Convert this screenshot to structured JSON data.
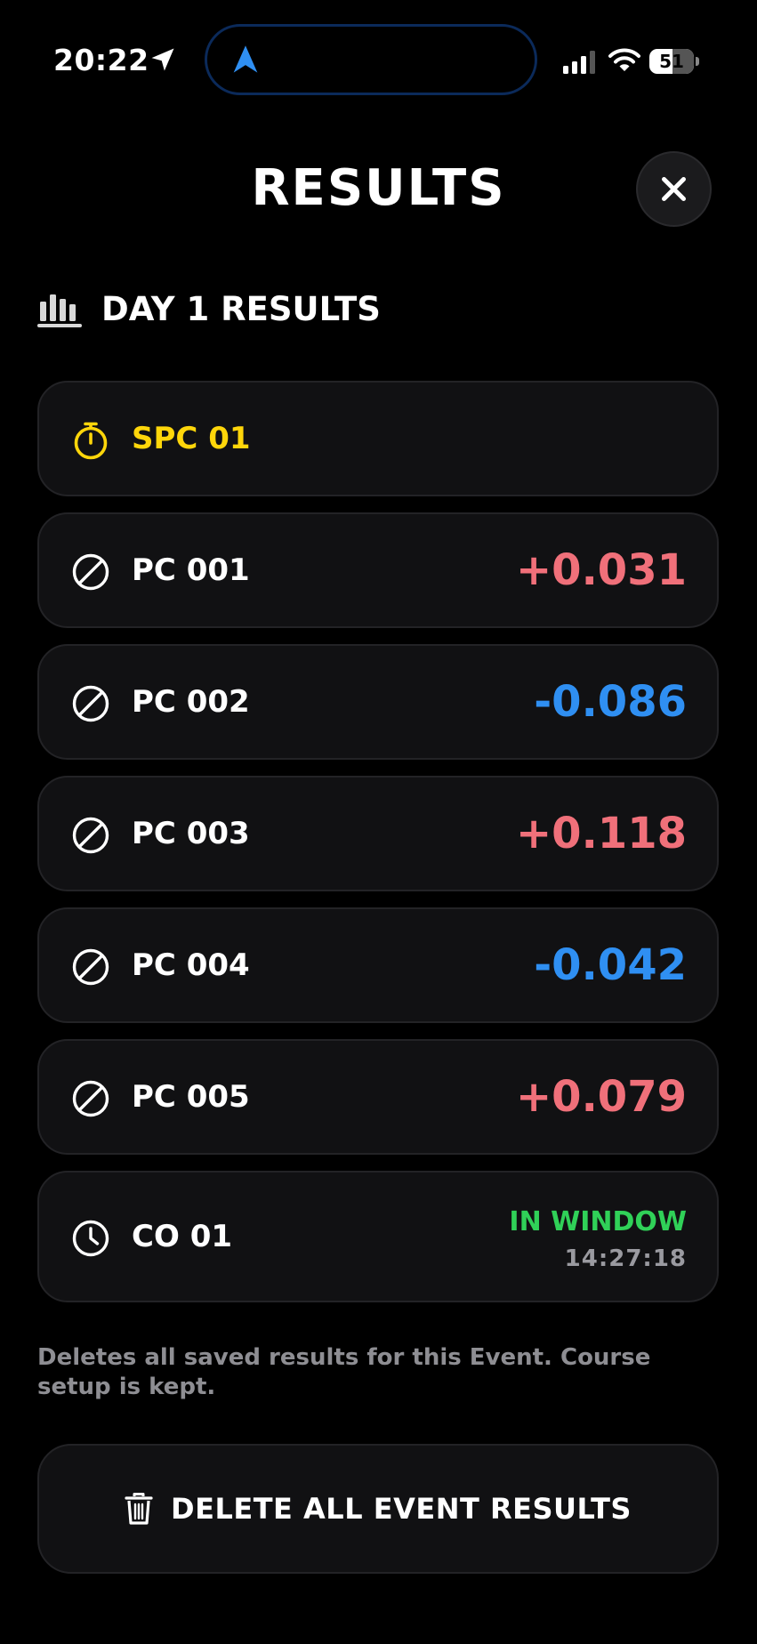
{
  "status_bar": {
    "time": "20:22",
    "battery": "51",
    "battery_level": 0.51
  },
  "header": {
    "title": "RESULTS"
  },
  "section": {
    "title": "DAY 1 RESULTS"
  },
  "results": [
    {
      "label": "SPC 01",
      "icon": "stopwatch-icon",
      "value": ""
    },
    {
      "label": "PC 001",
      "icon": "prohibited-icon",
      "value": "+0.031"
    },
    {
      "label": "PC 002",
      "icon": "prohibited-icon",
      "value": "-0.086"
    },
    {
      "label": "PC 003",
      "icon": "prohibited-icon",
      "value": "+0.118"
    },
    {
      "label": "PC 004",
      "icon": "prohibited-icon",
      "value": "-0.042"
    },
    {
      "label": "PC 005",
      "icon": "prohibited-icon",
      "value": "+0.079"
    },
    {
      "label": "CO 01",
      "icon": "clock-icon",
      "status": "IN WINDOW",
      "time": "14:27:18"
    }
  ],
  "footer": {
    "note": "Deletes all saved results for this Event. Course setup is kept.",
    "delete_label": "DELETE ALL EVENT RESULTS"
  },
  "colors": {
    "positive": "#f0707a",
    "negative": "#2f8ff2",
    "in_window": "#30d158",
    "highlight": "#ffd60a"
  }
}
